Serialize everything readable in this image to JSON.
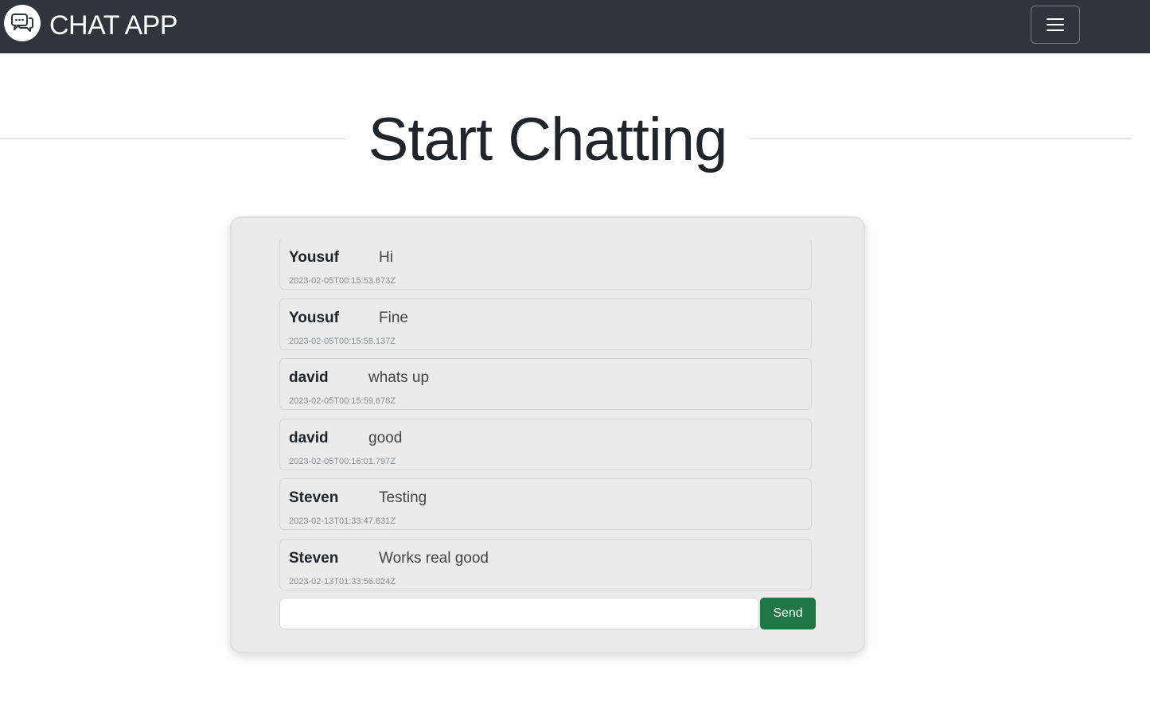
{
  "navbar": {
    "brand_text": "CHAT APP",
    "logo_icon": "chat-bubbles-icon",
    "menu_icon": "hamburger-menu-icon"
  },
  "main": {
    "title": "Start Chatting"
  },
  "messages": [
    {
      "user": "Yousuf",
      "text": "Hi",
      "timestamp": "2023-02-05T00:15:53.673Z"
    },
    {
      "user": "Yousuf",
      "text": "Fine",
      "timestamp": "2023-02-05T00:15:58.137Z"
    },
    {
      "user": "david",
      "text": "whats up",
      "timestamp": "2023-02-05T00:15:59.678Z"
    },
    {
      "user": "david",
      "text": "good",
      "timestamp": "2023-02-05T00:16:01.797Z"
    },
    {
      "user": "Steven",
      "text": "Testing",
      "timestamp": "2023-02-13T01:33:47.631Z"
    },
    {
      "user": "Steven",
      "text": "Works real good",
      "timestamp": "2023-02-13T01:33:56.024Z"
    }
  ],
  "composer": {
    "input_value": "",
    "send_label": "Send"
  },
  "colors": {
    "navbar_bg": "#30343c",
    "send_button_bg": "#1e7744",
    "card_bg": "#ebebeb"
  }
}
